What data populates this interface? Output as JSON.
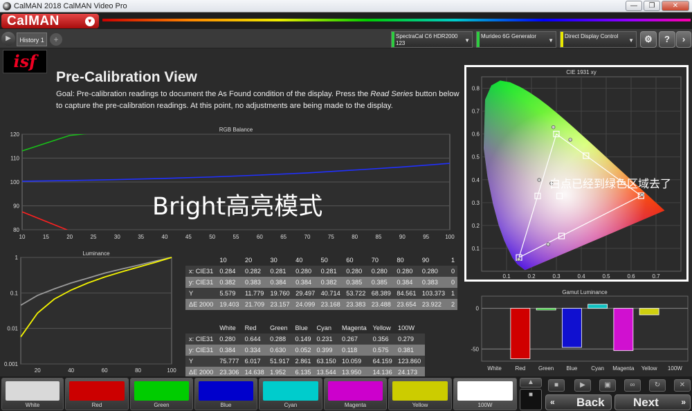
{
  "window": {
    "title": "CalMAN 2018 CalMAN Video Pro",
    "buttons": [
      "—",
      "❐",
      "✕"
    ]
  },
  "menu": {
    "logo": "CalMAN"
  },
  "tabs": [
    {
      "label": "History 1"
    }
  ],
  "devices": [
    {
      "line1": "SpectraCal C6 HDR2000",
      "line2": "123",
      "color": "#2ecc40"
    },
    {
      "line1": "Murideo 6G Generator",
      "line2": "",
      "color": "#2ecc40"
    },
    {
      "line1": "Direct Display Control",
      "line2": "",
      "color": "#e8e800"
    }
  ],
  "header": {
    "logo_text": "isf",
    "title": "Pre-Calibration View",
    "goal_part1": "Goal: Pre-calibration readings to document the As Found condition of the display. Press the ",
    "goal_em": "Read Series",
    "goal_part2": " button below to capture the pre-calibration readings. At this point, no adjustments are being made to the display."
  },
  "overlays": {
    "bright": "Bright高亮模式",
    "whitepoint": "白点已经到绿色区域去了"
  },
  "chart_data": [
    {
      "type": "line",
      "title": "RGB Balance",
      "x": [
        10,
        20,
        30,
        40,
        50,
        60,
        70,
        80,
        90,
        100
      ],
      "ylim": [
        80,
        120
      ],
      "xlim": [
        10,
        100
      ],
      "yticks": [
        80,
        90,
        100,
        110,
        120
      ],
      "xticks": [
        10,
        15,
        20,
        25,
        30,
        35,
        40,
        45,
        50,
        55,
        60,
        65,
        70,
        75,
        80,
        85,
        90,
        95,
        100
      ],
      "series": [
        {
          "color": "#ff2020",
          "values": [
            87.5,
            79.5,
            74,
            70,
            67,
            64.5,
            62.5,
            61,
            60,
            59
          ]
        },
        {
          "color": "#18c018",
          "values": [
            113,
            119.5,
            121.5,
            122,
            122.5,
            123,
            123,
            123.5,
            123.5,
            124
          ]
        },
        {
          "color": "#2030ff",
          "values": [
            100.3,
            100.6,
            101.0,
            101.5,
            102.1,
            102.9,
            103.8,
            105.0,
            106.3,
            107.8
          ]
        }
      ]
    },
    {
      "type": "line",
      "title": "Luminance",
      "ylog": true,
      "ylim": [
        0.001,
        1
      ],
      "xlim": [
        10,
        100
      ],
      "yticks": [
        "1",
        "0.1",
        "0.01",
        "0.001"
      ],
      "xticks": [
        20,
        40,
        60,
        80,
        100
      ],
      "series": [
        {
          "name": "target",
          "color": "#9a9a9a",
          "x": [
            10,
            20,
            30,
            40,
            50,
            60,
            70,
            80,
            90,
            100
          ],
          "values": [
            0.045,
            0.085,
            0.13,
            0.19,
            0.26,
            0.36,
            0.47,
            0.6,
            0.78,
            1.0
          ]
        },
        {
          "name": "measured",
          "color": "#f5f500",
          "x": [
            10,
            20,
            30,
            40,
            50,
            60,
            70,
            80,
            90,
            100
          ],
          "values": [
            0.0058,
            0.027,
            0.067,
            0.12,
            0.19,
            0.28,
            0.39,
            0.53,
            0.72,
            1.0
          ]
        }
      ]
    },
    {
      "type": "scatter",
      "title": "CIE 1931 xy",
      "xlim": [
        0,
        0.8
      ],
      "ylim": [
        0,
        0.85
      ],
      "xticks": [
        0.1,
        0.2,
        0.3,
        0.4,
        0.5,
        0.6,
        0.7
      ],
      "yticks": [
        0.1,
        0.2,
        0.3,
        0.4,
        0.5,
        0.6,
        0.7,
        0.8
      ],
      "gamut": [
        [
          0.64,
          0.33
        ],
        [
          0.3,
          0.6
        ],
        [
          0.15,
          0.06
        ]
      ],
      "targets": [
        [
          0.64,
          0.33
        ],
        [
          0.3,
          0.6
        ],
        [
          0.15,
          0.06
        ],
        [
          0.225,
          0.329
        ],
        [
          0.321,
          0.154
        ],
        [
          0.419,
          0.505
        ],
        [
          0.3127,
          0.329
        ]
      ],
      "measured": [
        [
          0.644,
          0.334
        ],
        [
          0.288,
          0.63
        ],
        [
          0.149,
          0.052
        ],
        [
          0.231,
          0.399
        ],
        [
          0.267,
          0.118
        ],
        [
          0.356,
          0.575
        ],
        [
          0.28,
          0.384
        ]
      ]
    },
    {
      "type": "bar",
      "title": "Gamut Luminance",
      "categories": [
        "White",
        "Red",
        "Green",
        "Blue",
        "Cyan",
        "Magenta",
        "Yellow",
        "100W"
      ],
      "values": [
        0,
        -62,
        -2,
        -48,
        5,
        -52,
        -8,
        0
      ],
      "colors": [
        "#ffffff",
        "#d00000",
        "#10c010",
        "#1010d0",
        "#10c0c0",
        "#d010d0",
        "#d0d010",
        "#ffffff"
      ],
      "ylim": [
        -65,
        15
      ],
      "yticks": [
        0,
        -50
      ]
    }
  ],
  "grayscale_table": {
    "headers": [
      "",
      "10",
      "20",
      "30",
      "40",
      "50",
      "60",
      "70",
      "80",
      "90",
      "1"
    ],
    "rows": [
      [
        "x: CIE31",
        "0.284",
        "0.282",
        "0.281",
        "0.280",
        "0.281",
        "0.280",
        "0.280",
        "0.280",
        "0.280",
        "0"
      ],
      [
        "y: CIE31",
        "0.382",
        "0.383",
        "0.384",
        "0.384",
        "0.382",
        "0.385",
        "0.385",
        "0.384",
        "0.383",
        "0"
      ],
      [
        "Y",
        "5.579",
        "11.779",
        "19.760",
        "29.497",
        "40.714",
        "53.722",
        "68.389",
        "84.561",
        "103.373",
        "1"
      ],
      [
        "ΔE 2000",
        "19.403",
        "21.709",
        "23.157",
        "24.099",
        "23.168",
        "23.383",
        "23.488",
        "23.654",
        "23.922",
        "2"
      ]
    ]
  },
  "color_table": {
    "headers": [
      "",
      "White",
      "Red",
      "Green",
      "Blue",
      "Cyan",
      "Magenta",
      "Yellow",
      "100W"
    ],
    "rows": [
      [
        "x: CIE31",
        "0.280",
        "0.644",
        "0.288",
        "0.149",
        "0.231",
        "0.267",
        "0.356",
        "0.279"
      ],
      [
        "y: CIE31",
        "0.384",
        "0.334",
        "0.630",
        "0.052",
        "0.399",
        "0.118",
        "0.575",
        "0.381"
      ],
      [
        "Y",
        "75.777",
        "6.017",
        "51.917",
        "2.861",
        "63.150",
        "10.059",
        "64.159",
        "123.860"
      ],
      [
        "ΔE 2000",
        "23.306",
        "14.638",
        "1.952",
        "6.135",
        "13.544",
        "13.950",
        "14.136",
        "24.173"
      ]
    ]
  },
  "swatches": [
    {
      "label": "White",
      "color": "#d9d9d9"
    },
    {
      "label": "Red",
      "color": "#cc0000"
    },
    {
      "label": "Green",
      "color": "#00cc00"
    },
    {
      "label": "Blue",
      "color": "#0000cc"
    },
    {
      "label": "Cyan",
      "color": "#00cccc"
    },
    {
      "label": "Magenta",
      "color": "#cc00cc"
    },
    {
      "label": "Yellow",
      "color": "#cccc00"
    },
    {
      "label": "100W",
      "color": "#ffffff"
    }
  ],
  "nav": {
    "back": "Back",
    "next": "Next"
  }
}
